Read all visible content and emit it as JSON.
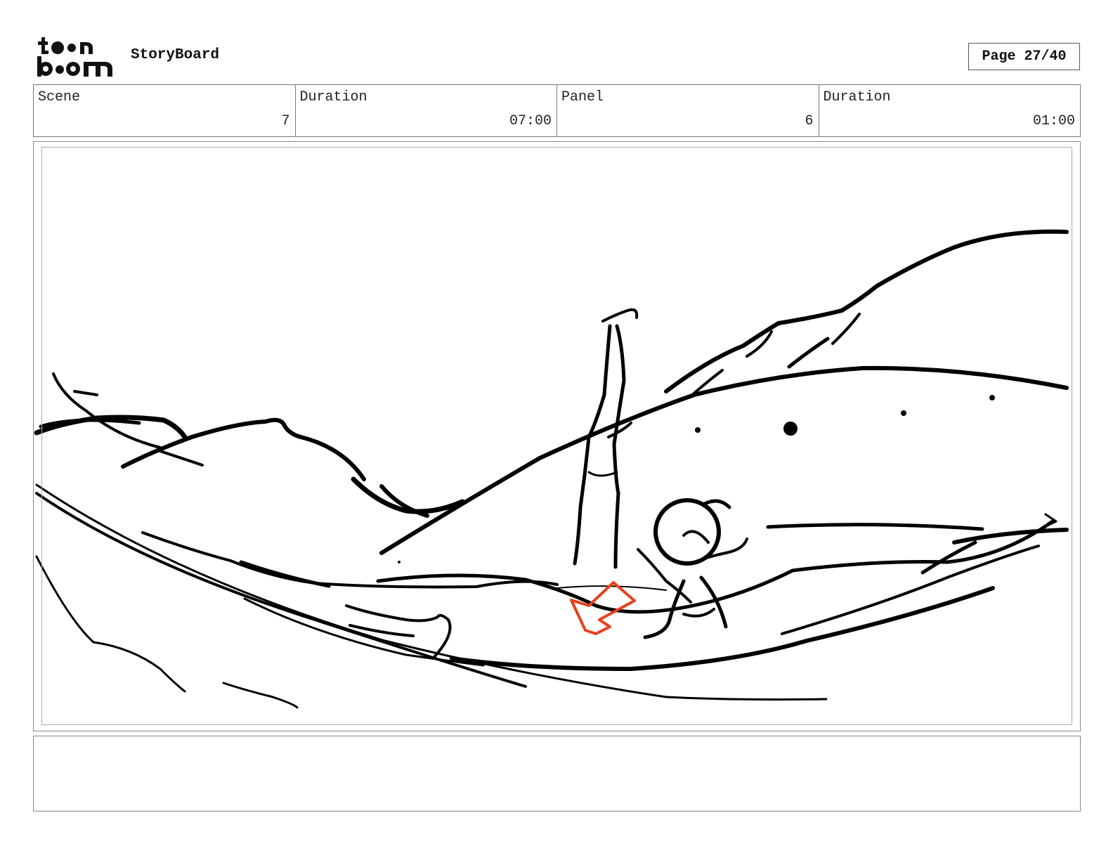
{
  "header": {
    "logo_icon": "toon-boom-logo",
    "app_title": "StoryBoard",
    "page_indicator": "Page 27/40"
  },
  "info_bar": {
    "scene": {
      "label": "Scene",
      "value": "7"
    },
    "scene_duration": {
      "label": "Duration",
      "value": "07:00"
    },
    "panel": {
      "label": "Panel",
      "value": "6"
    },
    "panel_duration": {
      "label": "Duration",
      "value": "01:00"
    }
  },
  "panel": {
    "sketch_icon": "storyboard-sketch",
    "ink_color": "#000000",
    "accent_color": "#e8401e"
  },
  "notes": {
    "text": ""
  }
}
